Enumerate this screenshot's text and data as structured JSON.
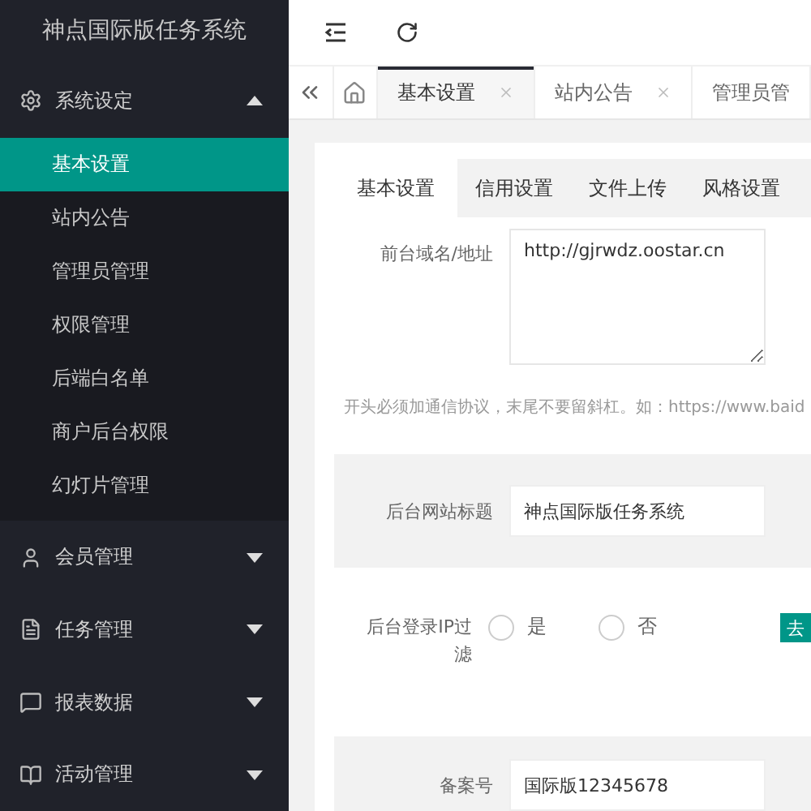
{
  "sidebar": {
    "title": "神点国际版任务系统",
    "groups": [
      {
        "label": "系统设定",
        "expanded": true,
        "items": [
          {
            "label": "基本设置",
            "selected": true
          },
          {
            "label": "站内公告",
            "selected": false
          },
          {
            "label": "管理员管理",
            "selected": false
          },
          {
            "label": "权限管理",
            "selected": false
          },
          {
            "label": "后端白名单",
            "selected": false
          },
          {
            "label": "商户后台权限",
            "selected": false
          },
          {
            "label": "幻灯片管理",
            "selected": false
          }
        ]
      },
      {
        "label": "会员管理",
        "expanded": false
      },
      {
        "label": "任务管理",
        "expanded": false
      },
      {
        "label": "报表数据",
        "expanded": false
      },
      {
        "label": "活动管理",
        "expanded": false
      }
    ]
  },
  "page_tabs": [
    {
      "label": "基本设置",
      "selected": true
    },
    {
      "label": "站内公告",
      "selected": false
    },
    {
      "label": "管理员管",
      "selected": false
    }
  ],
  "settings_tabs": [
    {
      "label": "基本设置",
      "selected": true
    },
    {
      "label": "信用设置",
      "selected": false
    },
    {
      "label": "文件上传",
      "selected": false
    },
    {
      "label": "风格设置",
      "selected": false
    }
  ],
  "form": [
    {
      "kind": "textarea",
      "label": "前台域名/地址",
      "value": "http://gjrwdz.oostar.cn",
      "hint": "开头必须加通信协议，末尾不要留斜杠。如：https://www.baid"
    },
    {
      "kind": "input",
      "label": "后台网站标题",
      "value": "神点国际版任务系统"
    },
    {
      "kind": "radio",
      "label": "后台登录IP过滤",
      "options": [
        {
          "label": "是",
          "selected": false
        },
        {
          "label": "否",
          "selected": false
        }
      ],
      "button": "去"
    },
    {
      "kind": "input",
      "label": "备案号",
      "value": "国际版12345678"
    }
  ]
}
